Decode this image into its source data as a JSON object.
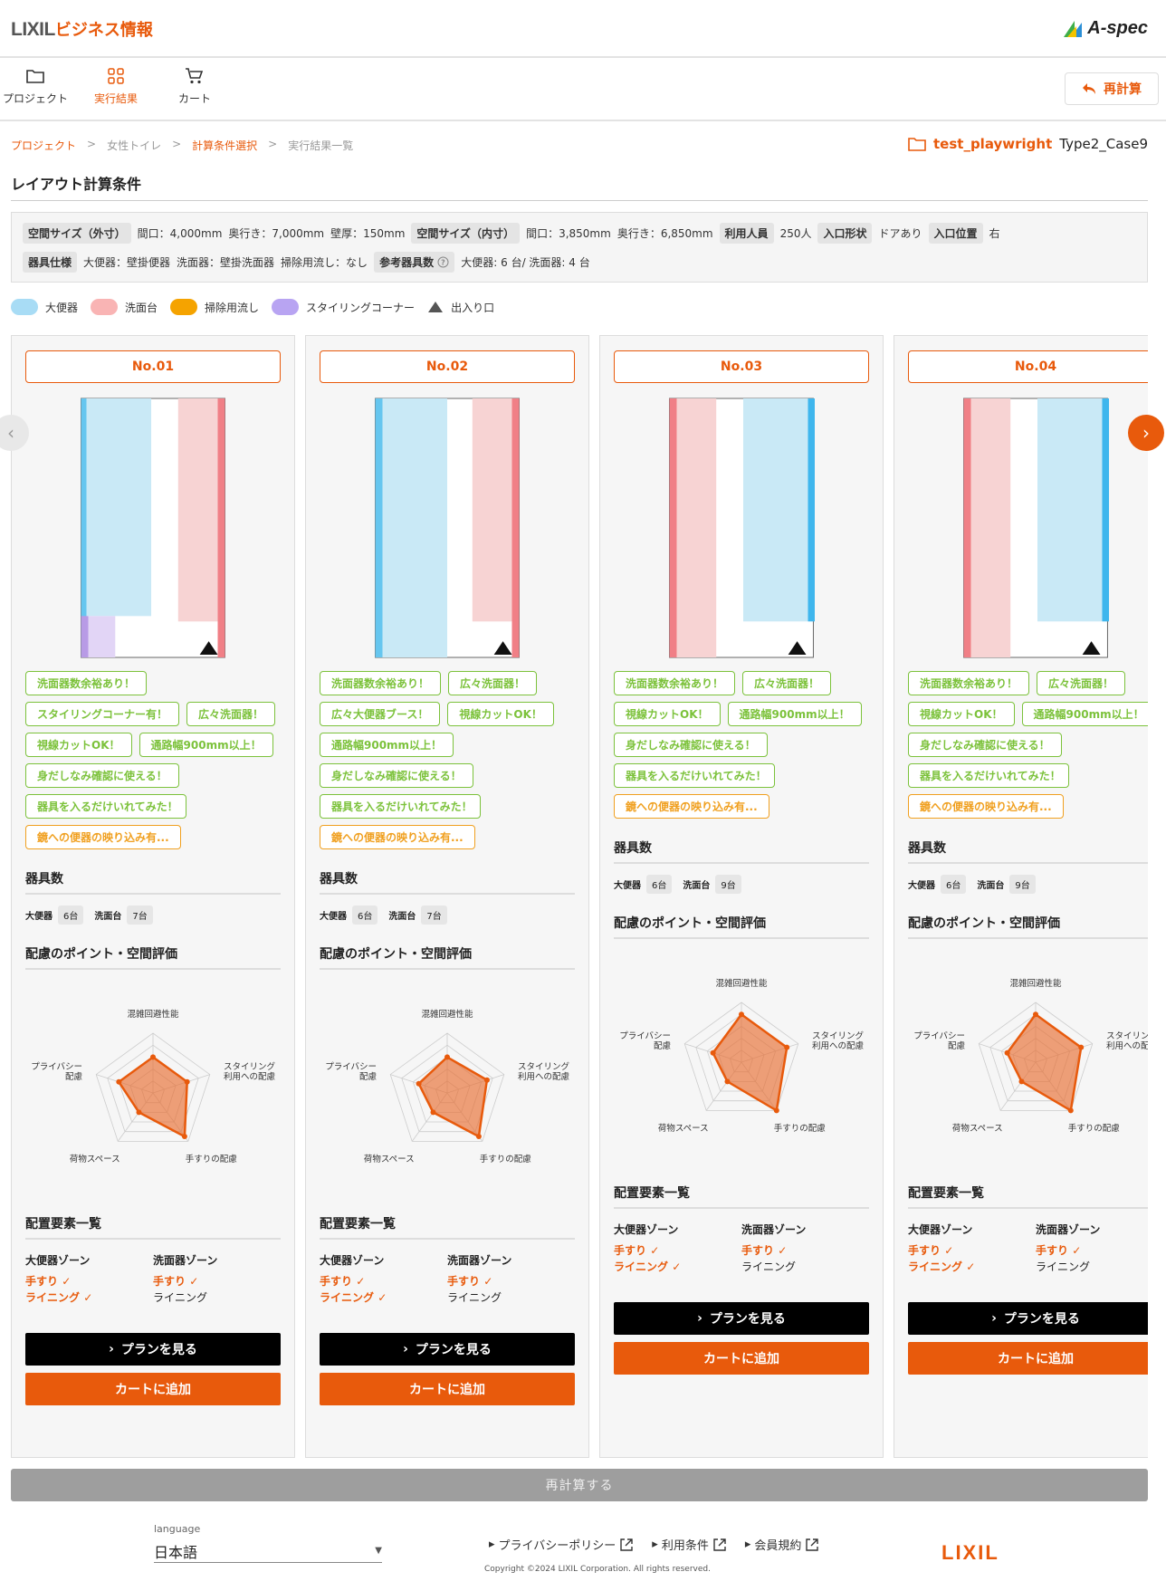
{
  "header": {
    "brand_a": "LIXIL",
    "brand_b": "ビジネス情報",
    "product": "A-spec"
  },
  "nav": {
    "items": [
      {
        "label": "プロジェクト",
        "icon": "folder-icon"
      },
      {
        "label": "実行結果",
        "icon": "grid-icon"
      },
      {
        "label": "カート",
        "icon": "cart-icon"
      }
    ],
    "recalc": "再計算"
  },
  "breadcrumb": [
    "プロジェクト",
    "女性トイレ",
    "計算条件選択",
    "実行結果一覧"
  ],
  "project": {
    "name": "test_playwright",
    "case": "Type2_Case9"
  },
  "section_title": "レイアウト計算条件",
  "conditions": {
    "outer_label": "空間サイズ（外寸）",
    "outer_width": "間口：4,000mm",
    "outer_depth": "奥行き：7,000mm",
    "wall": "壁厚：150mm",
    "inner_label": "空間サイズ（内寸）",
    "inner_width": "間口：3,850mm",
    "inner_depth": "奥行き：6,850mm",
    "users_label": "利用人員",
    "users": "250人",
    "entrance_label": "入口形状",
    "entrance": "ドアあり",
    "pos_label": "入口位置",
    "pos": "右",
    "spec_label": "器具仕様",
    "toilet_spec": "大便器：壁掛便器",
    "sink_spec": "洗面器：壁掛洗面器",
    "mop_spec": "掃除用流し：なし",
    "ref_label": "参考器具数",
    "ref": "大便器: 6 台/ 洗面器: 4 台"
  },
  "legend": [
    {
      "label": "大便器",
      "color": "#a8dcf5"
    },
    {
      "label": "洗面台",
      "color": "#f9b4b4"
    },
    {
      "label": "掃除用流し",
      "color": "#f5a300"
    },
    {
      "label": "スタイリングコーナー",
      "color": "#b8a4f2"
    },
    {
      "label": "出入り口",
      "icon": "triangle-icon"
    }
  ],
  "labels": {
    "count_title": "器具数",
    "toilet": "大便器",
    "sink": "洗面台",
    "radar_title": "配慮のポイント・空間評価",
    "zones_title": "配置要素一覧",
    "zone_toilet": "大便器ゾーン",
    "zone_sink": "洗面器ゾーン",
    "handrail": "手すり",
    "lining": "ライニング",
    "view_plan": "プランを見る",
    "add_cart": "カートに追加"
  },
  "radar_axes": [
    "混雑回避性能",
    "スタイリング\n利用への配慮",
    "手すりの配慮",
    "荷物スペース",
    "プライバシー\n配慮"
  ],
  "cards": [
    {
      "no": "No.01",
      "tags": [
        {
          "t": "洗面器数余裕あり！",
          "w": 0
        },
        {
          "t": "スタイリングコーナー有！",
          "w": 0
        },
        {
          "t": "広々洗面器！",
          "w": 0
        },
        {
          "t": "視線カットOK！",
          "w": 0
        },
        {
          "t": "通路幅900mm以上！",
          "w": 0
        },
        {
          "t": "身だしなみ確認に使える！",
          "w": 0
        },
        {
          "t": "器具を入るだけいれてみた！",
          "w": 0
        },
        {
          "t": "鏡への便器の映り込み有...",
          "w": 1
        }
      ],
      "toilets": "6台",
      "sinks": "7台",
      "radar": [
        0.6,
        0.6,
        0.9,
        0.4,
        0.6
      ],
      "sink_lining": false
    },
    {
      "no": "No.02",
      "tags": [
        {
          "t": "洗面器数余裕あり！",
          "w": 0
        },
        {
          "t": "広々洗面器！",
          "w": 0
        },
        {
          "t": "広々大便器ブース！",
          "w": 0
        },
        {
          "t": "視線カットOK！",
          "w": 0
        },
        {
          "t": "通路幅900mm以上！",
          "w": 0
        },
        {
          "t": "身だしなみ確認に使える！",
          "w": 0
        },
        {
          "t": "器具を入るだけいれてみた！",
          "w": 0
        },
        {
          "t": "鏡への便器の映り込み有...",
          "w": 1
        }
      ],
      "toilets": "6台",
      "sinks": "7台",
      "radar": [
        0.6,
        0.7,
        0.9,
        0.4,
        0.5
      ],
      "sink_lining": false
    },
    {
      "no": "No.03",
      "tags": [
        {
          "t": "洗面器数余裕あり！",
          "w": 0
        },
        {
          "t": "広々洗面器！",
          "w": 0
        },
        {
          "t": "視線カットOK！",
          "w": 0
        },
        {
          "t": "通路幅900mm以上！",
          "w": 0
        },
        {
          "t": "身だしなみ確認に使える！",
          "w": 0
        },
        {
          "t": "器具を入るだけいれてみた！",
          "w": 0
        },
        {
          "t": "鏡への便器の映り込み有...",
          "w": 1
        }
      ],
      "toilets": "6台",
      "sinks": "9台",
      "radar": [
        0.8,
        0.8,
        1.0,
        0.4,
        0.5
      ],
      "sink_lining": false
    },
    {
      "no": "No.04",
      "tags": [
        {
          "t": "洗面器数余裕あり！",
          "w": 0
        },
        {
          "t": "広々洗面器！",
          "w": 0
        },
        {
          "t": "視線カットOK！",
          "w": 0
        },
        {
          "t": "通路幅900mm以上！",
          "w": 0
        },
        {
          "t": "身だしなみ確認に使える！",
          "w": 0
        },
        {
          "t": "器具を入るだけいれてみた！",
          "w": 0
        },
        {
          "t": "鏡への便器の映り込み有...",
          "w": 1
        }
      ],
      "toilets": "6台",
      "sinks": "9台",
      "radar": [
        0.8,
        0.8,
        1.0,
        0.4,
        0.5
      ],
      "sink_lining": false
    }
  ],
  "recalc_button": "再計算する",
  "footer": {
    "lang_label": "language",
    "lang": "日本語",
    "links": [
      "プライバシーポリシー",
      "利用条件",
      "会員規約"
    ],
    "copyright": "Copyright ©2024 LIXIL Corporation. All rights reserved.",
    "logo": "LIXIL"
  }
}
